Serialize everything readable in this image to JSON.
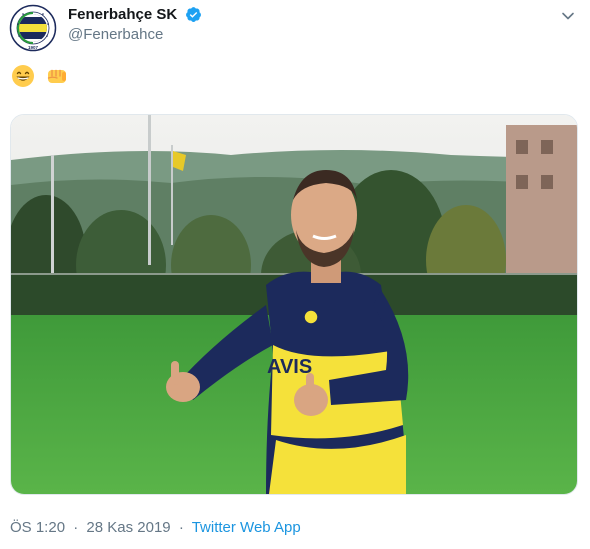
{
  "user": {
    "display_name": "Fenerbahçe SK",
    "handle": "@Fenerbahce",
    "avatar_text": "FENERBAHÇE SPOR KULÜBÜ",
    "avatar_year": "1907",
    "verified_icon": "verified-badge-icon"
  },
  "tweet": {
    "emojis": [
      "grinning-face-emoji",
      "oncoming-fist-emoji"
    ],
    "media_alt": "",
    "jersey_text": "AVIS"
  },
  "meta": {
    "time": "ÖS 1:20",
    "date": "28 Kas 2019",
    "separator": "·",
    "source": "Twitter Web App"
  },
  "colors": {
    "link": "#1b95e0",
    "secondary_text": "#657786",
    "verified": "#1da1f2",
    "fb_navy": "#1c2a5c",
    "fb_yellow": "#f5e13a"
  }
}
